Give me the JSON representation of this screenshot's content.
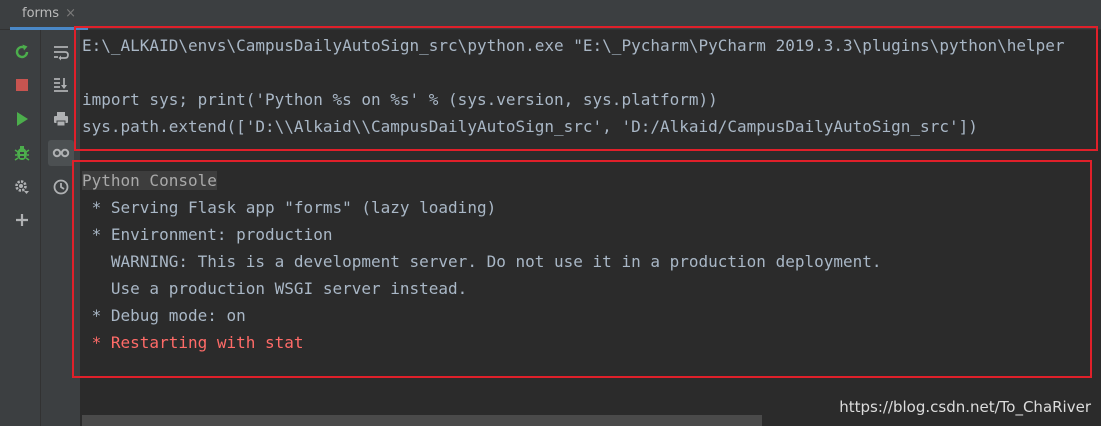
{
  "tab": {
    "title": "forms",
    "close": "×"
  },
  "toolbar": {
    "left_icons": [
      "rerun-icon",
      "stop-icon",
      "run-icon",
      "debug-icon",
      "settings-icon",
      "add-icon"
    ],
    "right_icons": [
      "soft-wrap-icon",
      "scroll-to-end-icon",
      "print-icon",
      "show-variables-icon",
      "history-icon"
    ]
  },
  "console": {
    "command_lines": [
      "E:\\_ALKAID\\envs\\CampusDailyAutoSign_src\\python.exe \"E:\\_Pycharm\\PyCharm 2019.3.3\\plugins\\python\\helper",
      "import sys; print('Python %s on %s' % (sys.version, sys.platform))",
      "sys.path.extend(['D:\\\\Alkaid\\\\CampusDailyAutoSign_src', 'D:/Alkaid/CampusDailyAutoSign_src'])"
    ],
    "label": "Python Console",
    "output_lines": [
      " * Serving Flask app \"forms\" (lazy loading)",
      " * Environment: production",
      "   WARNING: This is a development server. Do not use it in a production deployment.",
      "   Use a production WSGI server instead.",
      " * Debug mode: on"
    ],
    "restart_line": " * Restarting with stat"
  },
  "watermark": "https://blog.csdn.net/To_ChaRiver",
  "colors": {
    "console_text": "#a9b7c6",
    "error_text": "#ff6b68",
    "highlight_border": "#e0202a",
    "accent_green": "#4cae4c",
    "stop_red": "#c75450"
  }
}
